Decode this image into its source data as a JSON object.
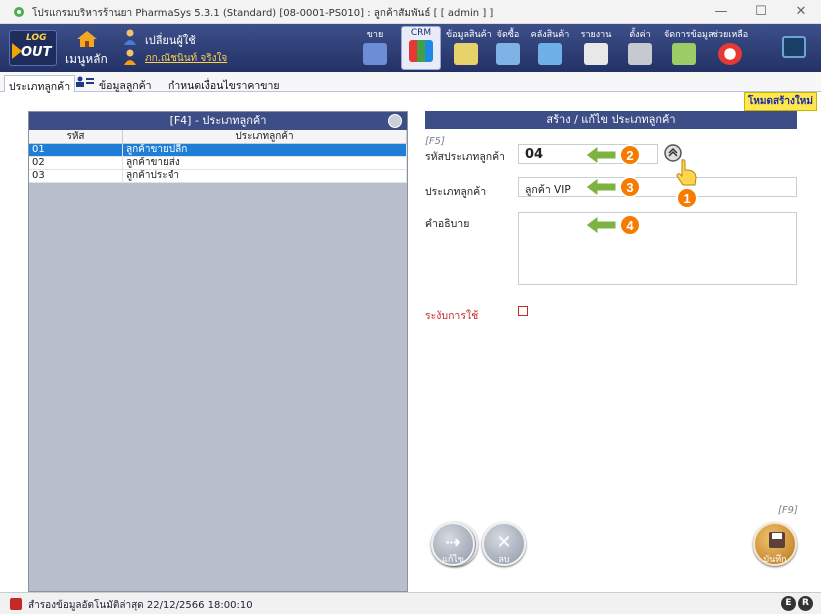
{
  "window": {
    "title": "โปรแกรมบริหารร้านยา PharmaSys 5.3.1 (Standard) [08-0001-PS010] : ลูกค้าสัมพันธ์ [ [ admin ] ]",
    "minimize": "—",
    "maximize": "☐",
    "close": "✕"
  },
  "toolbar": {
    "logout_top": "LOG",
    "logout_bottom": "OUT",
    "home_label": "เมนูหลัก",
    "change_user_label": "เปลี่ยนผู้ใช้",
    "user_name": "ภก.ณัชนินท์ จริงใจ",
    "buttons": [
      {
        "label": "ขาย"
      },
      {
        "label": "CRM"
      },
      {
        "label": "ข้อมูลสินค้า"
      },
      {
        "label": "จัดซื้อ"
      },
      {
        "label": "คลังสินค้า"
      },
      {
        "label": "รายงาน"
      },
      {
        "label": "ตั้งค่า"
      },
      {
        "label": "จัดการข้อมูล"
      },
      {
        "label": "ช่วยเหลือ"
      }
    ]
  },
  "tabs": [
    {
      "label": "ประเภทลูกค้า"
    },
    {
      "label": "ข้อมูลลูกค้า"
    },
    {
      "label": "กำหนดเงื่อนไขราคาขาย"
    }
  ],
  "mode_badge": "โหมดสร้างใหม่",
  "left_panel": {
    "title": "[F4] - ประเภทลูกค้า",
    "columns": [
      "รหัส",
      "ประเภทลูกค้า"
    ],
    "rows": [
      {
        "code": "01",
        "name": "ลูกค้าขายปลีก"
      },
      {
        "code": "02",
        "name": "ลูกค้าขายส่ง"
      },
      {
        "code": "03",
        "name": "ลูกค้าประจำ"
      }
    ],
    "edit_button": "แก้ไข",
    "delete_button": "ลบ"
  },
  "form": {
    "title": "สร้าง / แก้ไข ประเภทลูกค้า",
    "f5_hint": "[F5]",
    "code_label": "รหัสประเภทลูกค้า",
    "code_value": "04",
    "type_label": "ประเภทลูกค้า",
    "type_value": "ลูกค้า VIP",
    "desc_label": "คำอธิบาย",
    "desc_value": "",
    "suspend_label": "ระงับการใช้",
    "f9_hint": "[F9]",
    "save_button": "บันทึก",
    "callouts": [
      "1",
      "2",
      "3",
      "4"
    ]
  },
  "statusbar": {
    "text": "สำรองข้อมูลอัตโนมัติล่าสุด  22/12/2566 18:00:10",
    "badge_e": "E",
    "badge_r": "R"
  },
  "colors": {
    "header_blue": "#3d4d86",
    "selected_row": "#1f7fd6",
    "mode_badge_bg": "#ffe84d",
    "callout_green": "#7cb342",
    "callout_orange": "#f57c00"
  }
}
